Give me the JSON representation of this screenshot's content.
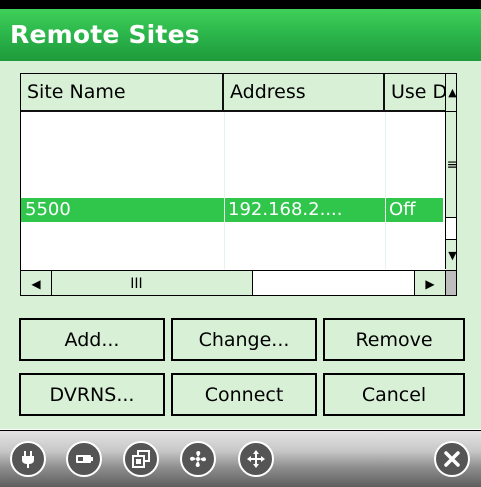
{
  "window": {
    "title": "Remote Sites"
  },
  "table": {
    "columns": [
      "Site Name",
      "Address",
      "Use D"
    ],
    "rows": [
      {
        "site": "",
        "address": "",
        "use": ""
      },
      {
        "site": "",
        "address": "",
        "use": ""
      },
      {
        "site": "",
        "address": "",
        "use": ""
      },
      {
        "site": "5500",
        "address": "192.168.2....",
        "use": "Off"
      },
      {
        "site": "",
        "address": "",
        "use": ""
      },
      {
        "site": "",
        "address": "",
        "use": ""
      }
    ],
    "selected_row": 3
  },
  "buttons": {
    "add": "Add...",
    "change": "Change...",
    "remove": "Remove",
    "dvrns": "DVRNS...",
    "connect": "Connect",
    "cancel": "Cancel"
  },
  "scroll": {
    "up_glyph": "▲",
    "down_glyph": "▼",
    "left_glyph": "◀",
    "right_glyph": "▶",
    "vthumb_glyph": "≡",
    "hthumb_glyph": "III"
  },
  "taskbar": {
    "icons": [
      "plug-icon",
      "battery-icon",
      "windows-icon",
      "fan-icon",
      "move-icon",
      "close-icon"
    ]
  }
}
